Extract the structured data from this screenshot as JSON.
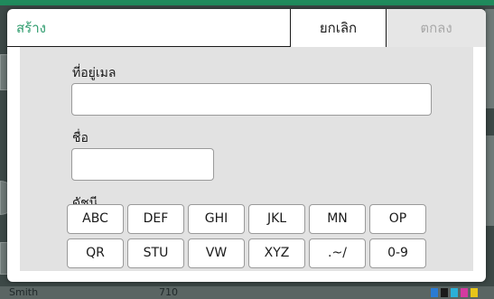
{
  "background": {
    "user_name": "Smith",
    "code": "710"
  },
  "dialog": {
    "title": "สร้าง",
    "cancel_label": "ยกเลิก",
    "ok_label": "ตกลง",
    "email_label": "ที่อยู่เมล",
    "email_value": "",
    "name_label": "ชื่อ",
    "name_value": "",
    "index_label": "ดัชนี",
    "index_keys": [
      "ABC",
      "DEF",
      "GHI",
      "JKL",
      "MN",
      "OP",
      "QR",
      "STU",
      "VW",
      "XYZ",
      ".~/",
      "0-9"
    ]
  },
  "colors": {
    "accent": "#2f9c6e",
    "disabled_text": "#a8a8a8"
  }
}
